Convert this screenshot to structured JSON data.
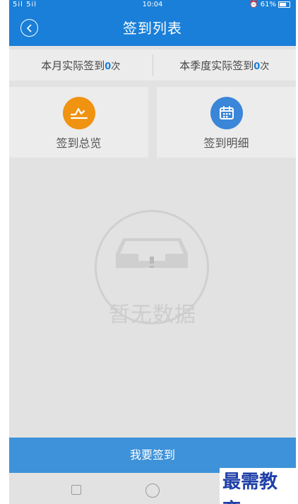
{
  "status_bar": {
    "signal": "5il 5il",
    "time": "10:04",
    "battery": "61%"
  },
  "header": {
    "title": "签到列表"
  },
  "stats": {
    "month_label": "本月实际签到",
    "month_count": "0",
    "quarter_label": "本季度实际签到",
    "quarter_count": "0",
    "unit": "次"
  },
  "cards": {
    "overview_label": "签到总览",
    "detail_label": "签到明细"
  },
  "empty_state": {
    "text": "暂无数据"
  },
  "footer": {
    "sign_in_button": "我要签到"
  },
  "watermark": {
    "text": "最需教育"
  },
  "colors": {
    "accent": "#1a7fd8",
    "overview_icon": "#ef9311",
    "detail_icon": "#3a86d8",
    "bottom_button": "#3e92d9"
  }
}
